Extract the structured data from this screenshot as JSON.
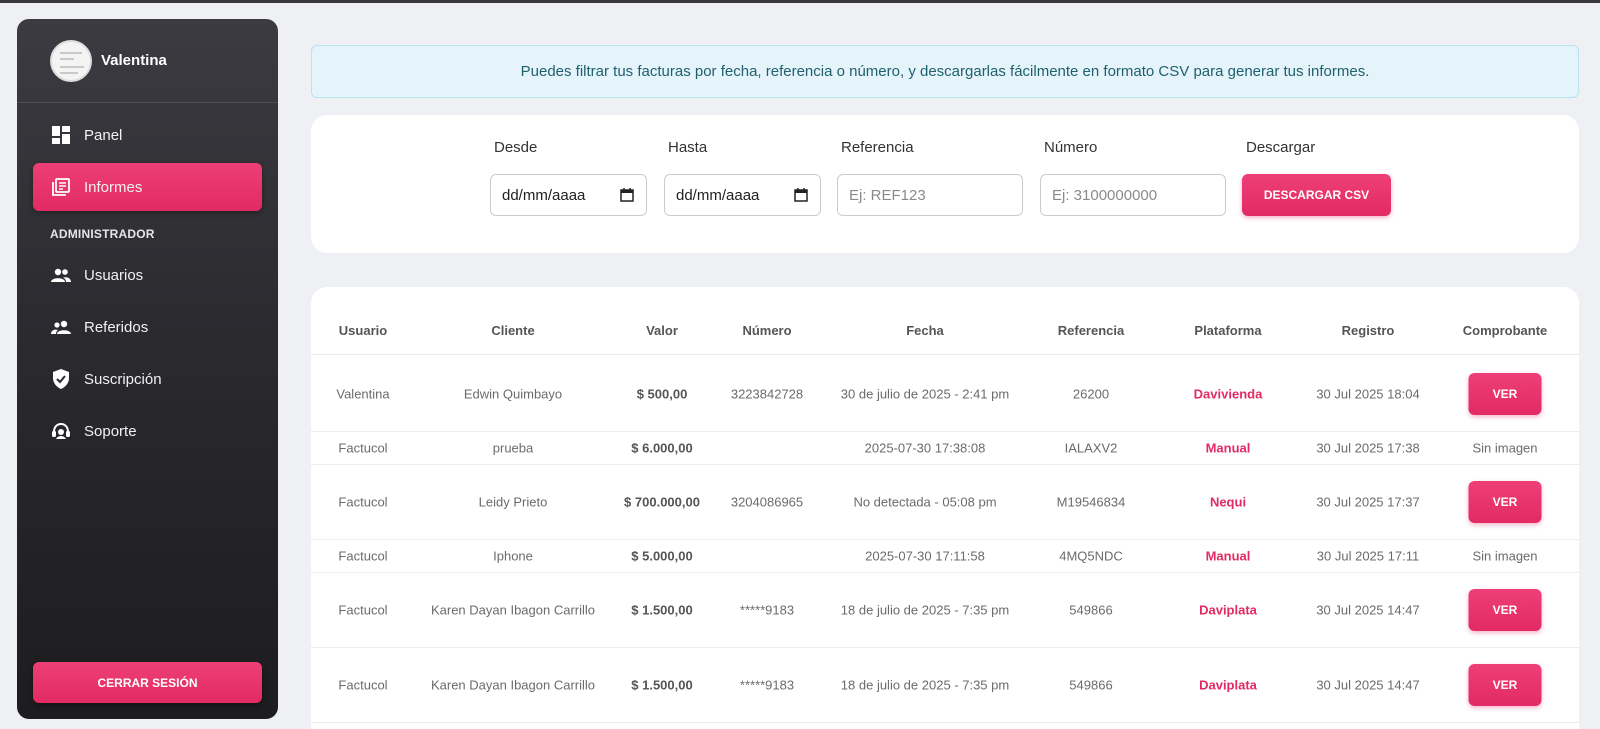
{
  "user": {
    "name": "Valentina"
  },
  "sidebar": {
    "items": [
      {
        "label": "Panel",
        "icon": "dashboard-icon",
        "active": false
      },
      {
        "label": "Informes",
        "icon": "reports-icon",
        "active": true
      }
    ],
    "section_label": "ADMINISTRADOR",
    "admin_items": [
      {
        "label": "Usuarios",
        "icon": "users-icon"
      },
      {
        "label": "Referidos",
        "icon": "referrals-icon"
      },
      {
        "label": "Suscripción",
        "icon": "shield-check-icon"
      },
      {
        "label": "Soporte",
        "icon": "support-headset-icon"
      }
    ],
    "logout_label": "CERRAR SESIÓN"
  },
  "info_banner": "Puedes filtrar tus facturas por fecha, referencia o número, y descargarlas fácilmente en formato CSV para generar tus informes.",
  "filters": {
    "desde": {
      "label": "Desde",
      "value": "dd/mm/aaaa"
    },
    "hasta": {
      "label": "Hasta",
      "value": "dd/mm/aaaa"
    },
    "referencia": {
      "label": "Referencia",
      "placeholder": "Ej: REF123"
    },
    "numero": {
      "label": "Número",
      "placeholder": "Ej: 3100000000"
    },
    "descargar": {
      "label": "Descargar",
      "button": "DESCARGAR CSV"
    }
  },
  "table": {
    "headers": [
      "Usuario",
      "Cliente",
      "Valor",
      "Número",
      "Fecha",
      "Referencia",
      "Plataforma",
      "Registro",
      "Comprobante"
    ],
    "rows": [
      {
        "usuario": "Valentina",
        "cliente": "Edwin Quimbayo",
        "valor": "$ 500,00",
        "numero": "3223842728",
        "fecha": "30 de julio de 2025 - 2:41 pm",
        "referencia": "26200",
        "plataforma": "Davivienda",
        "registro": "30 Jul 2025 18:04",
        "comprobante": "VER"
      },
      {
        "usuario": "Factucol",
        "cliente": "prueba",
        "valor": "$ 6.000,00",
        "numero": "",
        "fecha": "2025-07-30 17:38:08",
        "referencia": "IALAXV2",
        "plataforma": "Manual",
        "registro": "30 Jul 2025 17:38",
        "comprobante": "Sin imagen"
      },
      {
        "usuario": "Factucol",
        "cliente": "Leidy Prieto",
        "valor": "$ 700.000,00",
        "numero": "3204086965",
        "fecha": "No detectada - 05:08 pm",
        "referencia": "M19546834",
        "plataforma": "Nequi",
        "registro": "30 Jul 2025 17:37",
        "comprobante": "VER"
      },
      {
        "usuario": "Factucol",
        "cliente": "Iphone",
        "valor": "$ 5.000,00",
        "numero": "",
        "fecha": "2025-07-30 17:11:58",
        "referencia": "4MQ5NDC",
        "plataforma": "Manual",
        "registro": "30 Jul 2025 17:11",
        "comprobante": "Sin imagen"
      },
      {
        "usuario": "Factucol",
        "cliente": "Karen Dayan Ibagon Carrillo",
        "valor": "$ 1.500,00",
        "numero": "*****9183",
        "fecha": "18 de julio de 2025 - 7:35 pm",
        "referencia": "549866",
        "plataforma": "Daviplata",
        "registro": "30 Jul 2025 14:47",
        "comprobante": "VER"
      },
      {
        "usuario": "Factucol",
        "cliente": "Karen Dayan Ibagon Carrillo",
        "valor": "$ 1.500,00",
        "numero": "*****9183",
        "fecha": "18 de julio de 2025 - 7:35 pm",
        "referencia": "549866",
        "plataforma": "Daviplata",
        "registro": "30 Jul 2025 14:47",
        "comprobante": "VER"
      }
    ]
  },
  "colors": {
    "accent": "#e22a64",
    "sidebar_dark": "#2a2a2f",
    "info_bg": "#e4f4fa"
  }
}
